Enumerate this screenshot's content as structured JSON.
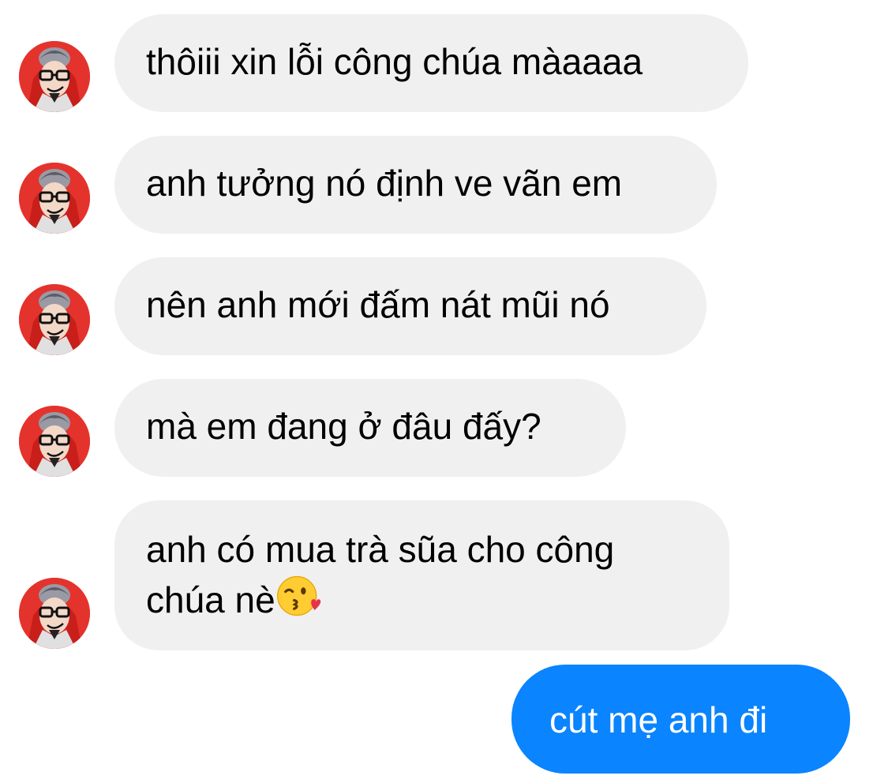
{
  "conversation": {
    "incoming": [
      {
        "text": "thôiii xin lỗi công chúa màaaaa"
      },
      {
        "text": "anh tưởng nó định ve vãn em"
      },
      {
        "text": "nên anh mới đấm nát mũi nó"
      },
      {
        "text": "mà em đang ở đâu đấy?"
      },
      {
        "line1": "anh có mua trà sũa cho công",
        "line2": "chúa nè",
        "emoji": "kissing-face-with-heart-emoji"
      }
    ],
    "outgoing": [
      {
        "text": "cút mẹ anh đi"
      }
    ]
  },
  "colors": {
    "incoming_bubble": "#f0f0f0",
    "outgoing_bubble": "#0a84ff",
    "avatar_hood": "#e4332c"
  }
}
